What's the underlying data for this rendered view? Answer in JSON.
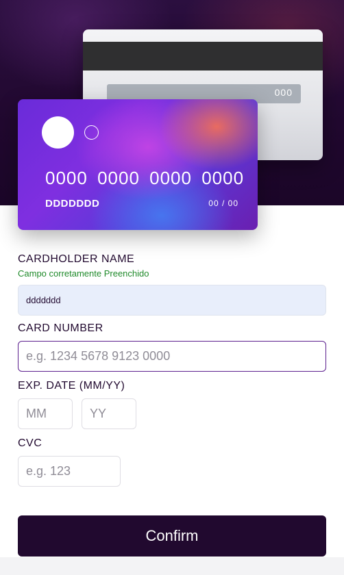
{
  "card_back": {
    "cvc": "000"
  },
  "card_front": {
    "number": "0000 0000 0000 0000",
    "name": "DDDDDDD",
    "expiry": "00 / 00"
  },
  "form": {
    "cardholder": {
      "label": "CARDHOLDER NAME",
      "status_message": "Campo corretamente Preenchido",
      "value": "ddddddd",
      "placeholder": ""
    },
    "card_number": {
      "label": "CARD NUMBER",
      "value": "",
      "placeholder": "e.g. 1234 5678 9123 0000"
    },
    "exp_date": {
      "label": "EXP. DATE (MM/YY)",
      "month_placeholder": "MM",
      "year_placeholder": "YY"
    },
    "cvc": {
      "label": "CVC",
      "placeholder": "e.g. 123"
    }
  },
  "confirm_label": "Confirm",
  "colors": {
    "dark_violet": "#21092f",
    "focus_border": "#5c1f8e",
    "success_green": "#1f8a2a",
    "autofill_bg": "#e8eefb"
  }
}
